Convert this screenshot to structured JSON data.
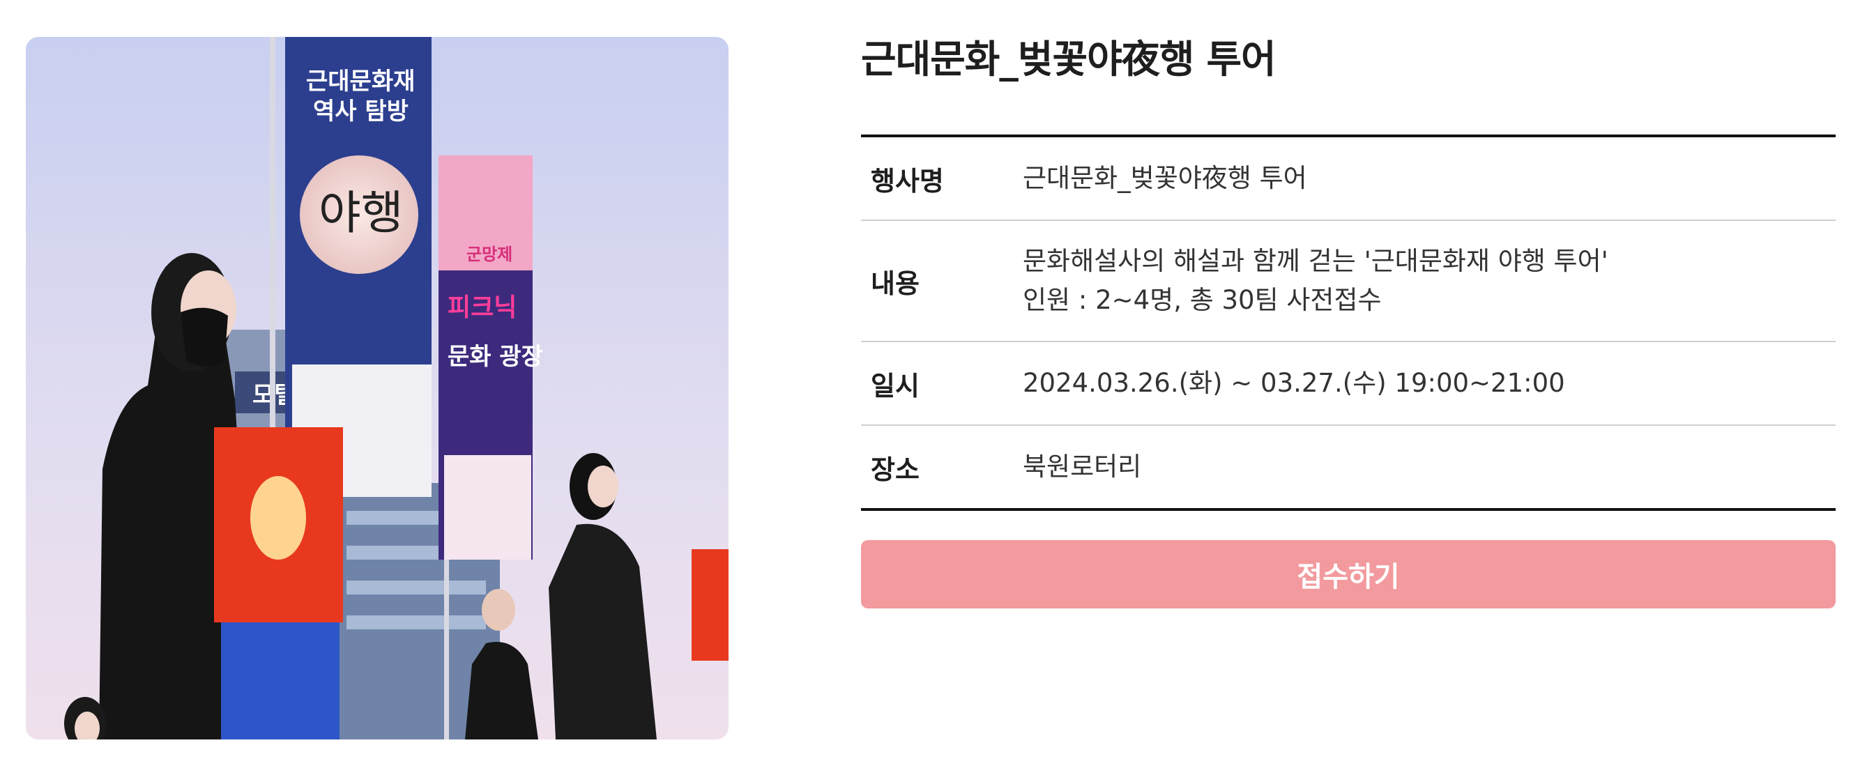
{
  "event": {
    "title": "근대문화_벚꽃야夜행 투어",
    "rows": [
      {
        "label": "행사명",
        "values": [
          "근대문화_벚꽃야夜행 투어"
        ]
      },
      {
        "label": "내용",
        "values": [
          "문화해설사의 해설과 함께 걷는 '근대문화재 야행 투어'",
          "인원 : 2~4명, 총 30팀 사전접수"
        ]
      },
      {
        "label": "일시",
        "values": [
          "2024.03.26.(화) ~ 03.27.(수) 19:00~21:00"
        ]
      },
      {
        "label": "장소",
        "values": [
          "북원로터리"
        ]
      }
    ],
    "apply_label": "접수하기"
  },
  "photo": {
    "banner1_top": "근대문화재",
    "banner1_mid": "역사 탐방",
    "banner1_calligraphy": "야행",
    "banner2_top": "군망제",
    "banner2_mid": "피크닉",
    "banner2_side": "문화 광장",
    "sign": "모텔"
  },
  "colors": {
    "accent": "#f29a9e",
    "rule": "#111111",
    "divider": "#cfcfcf"
  }
}
